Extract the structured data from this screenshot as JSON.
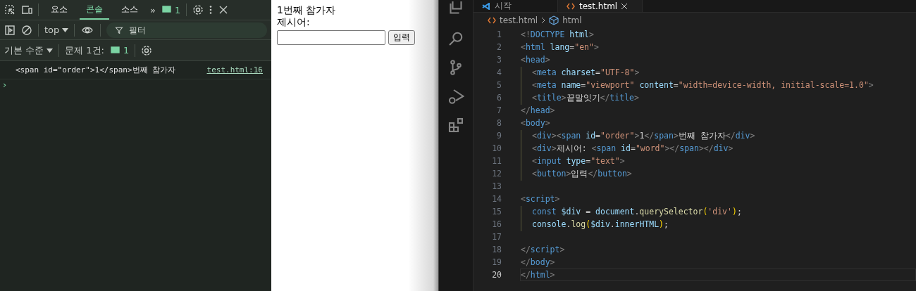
{
  "devtools": {
    "tabs": [
      {
        "label": "요소",
        "selected": false
      },
      {
        "label": "콘솔",
        "selected": true
      },
      {
        "label": "소스",
        "selected": false
      }
    ],
    "more": "»",
    "issues_badge": "1",
    "context": "top",
    "filter": {
      "placeholder": "필터"
    },
    "level_menu": "기본 수준",
    "issues_label": "문제 1건:",
    "issues_count": "1",
    "messages": [
      {
        "text": "<span id=\"order\">1</span>번째 참가자",
        "source": "test.html:16"
      }
    ],
    "prompt": "›"
  },
  "page": {
    "lines": [
      "1번째 참가자",
      "제시어:"
    ],
    "button": "입력"
  },
  "editor": {
    "tabs": [
      {
        "label": "시작",
        "selected": false
      },
      {
        "label": "test.html",
        "selected": true
      }
    ],
    "breadcrumb": [
      "test.html",
      "html"
    ],
    "lines": [
      {
        "n": "1",
        "current": false,
        "tokens": [
          {
            "t": "<!",
            "kind": "punct"
          },
          {
            "t": "DOCTYPE",
            "kind": "tag"
          },
          {
            "t": " html",
            "kind": "attr"
          },
          {
            "t": ">",
            "kind": "punct"
          }
        ]
      },
      {
        "n": "2",
        "current": false,
        "tokens": [
          {
            "t": "<",
            "kind": "punct"
          },
          {
            "t": "html",
            "kind": "tag"
          },
          {
            "t": " lang",
            "kind": "attr"
          },
          {
            "t": "=",
            "kind": "text"
          },
          {
            "t": "\"en\"",
            "kind": "string"
          },
          {
            "t": ">",
            "kind": "punct"
          }
        ]
      },
      {
        "n": "3",
        "current": false,
        "tokens": [
          {
            "t": "<",
            "kind": "punct"
          },
          {
            "t": "head",
            "kind": "tag"
          },
          {
            "t": ">",
            "kind": "punct"
          }
        ],
        "children": [
          {
            "n": "4",
            "current": false,
            "tokens": [
              {
                "t": "<",
                "kind": "punct"
              },
              {
                "t": "meta",
                "kind": "tag"
              },
              {
                "t": " charset",
                "kind": "attr"
              },
              {
                "t": "=",
                "kind": "text"
              },
              {
                "t": "\"UTF-8\"",
                "kind": "string"
              },
              {
                "t": ">",
                "kind": "punct"
              }
            ]
          },
          {
            "n": "5",
            "current": false,
            "tokens": [
              {
                "t": "<",
                "kind": "punct"
              },
              {
                "t": "meta",
                "kind": "tag"
              },
              {
                "t": " name",
                "kind": "attr"
              },
              {
                "t": "=",
                "kind": "text"
              },
              {
                "t": "\"viewport\"",
                "kind": "string"
              },
              {
                "t": " content",
                "kind": "attr"
              },
              {
                "t": "=",
                "kind": "text"
              },
              {
                "t": "\"width=device-width, initial-scale=1.0\"",
                "kind": "string"
              },
              {
                "t": ">",
                "kind": "punct"
              }
            ]
          },
          {
            "n": "6",
            "current": false,
            "tokens": [
              {
                "t": "<",
                "kind": "punct"
              },
              {
                "t": "title",
                "kind": "tag"
              },
              {
                "t": ">",
                "kind": "punct"
              },
              {
                "t": "끝말잇기",
                "kind": "text"
              },
              {
                "t": "</",
                "kind": "punct"
              },
              {
                "t": "title",
                "kind": "tag"
              },
              {
                "t": ">",
                "kind": "punct"
              }
            ]
          }
        ]
      },
      {
        "n": "7",
        "current": false,
        "tokens": [
          {
            "t": "</",
            "kind": "punct"
          },
          {
            "t": "head",
            "kind": "tag"
          },
          {
            "t": ">",
            "kind": "punct"
          }
        ]
      },
      {
        "n": "8",
        "current": false,
        "tokens": [
          {
            "t": "<",
            "kind": "punct"
          },
          {
            "t": "body",
            "kind": "tag"
          },
          {
            "t": ">",
            "kind": "punct"
          }
        ],
        "children": [
          {
            "n": "9",
            "current": false,
            "tokens": [
              {
                "t": "<",
                "kind": "punct"
              },
              {
                "t": "div",
                "kind": "tag"
              },
              {
                "t": "><",
                "kind": "punct"
              },
              {
                "t": "span",
                "kind": "tag"
              },
              {
                "t": " id",
                "kind": "attr"
              },
              {
                "t": "=",
                "kind": "text"
              },
              {
                "t": "\"order\"",
                "kind": "string"
              },
              {
                "t": ">",
                "kind": "punct"
              },
              {
                "t": "1",
                "kind": "text"
              },
              {
                "t": "</",
                "kind": "punct"
              },
              {
                "t": "span",
                "kind": "tag"
              },
              {
                "t": ">",
                "kind": "punct"
              },
              {
                "t": "번째 참가자",
                "kind": "text"
              },
              {
                "t": "</",
                "kind": "punct"
              },
              {
                "t": "div",
                "kind": "tag"
              },
              {
                "t": ">",
                "kind": "punct"
              }
            ]
          },
          {
            "n": "10",
            "current": false,
            "tokens": [
              {
                "t": "<",
                "kind": "punct"
              },
              {
                "t": "div",
                "kind": "tag"
              },
              {
                "t": ">",
                "kind": "punct"
              },
              {
                "t": "제시어: ",
                "kind": "text"
              },
              {
                "t": "<",
                "kind": "punct"
              },
              {
                "t": "span",
                "kind": "tag"
              },
              {
                "t": " id",
                "kind": "attr"
              },
              {
                "t": "=",
                "kind": "text"
              },
              {
                "t": "\"word\"",
                "kind": "string"
              },
              {
                "t": "></",
                "kind": "punct"
              },
              {
                "t": "span",
                "kind": "tag"
              },
              {
                "t": "></",
                "kind": "punct"
              },
              {
                "t": "div",
                "kind": "tag"
              },
              {
                "t": ">",
                "kind": "punct"
              }
            ]
          },
          {
            "n": "11",
            "current": false,
            "tokens": [
              {
                "t": "<",
                "kind": "punct"
              },
              {
                "t": "input",
                "kind": "tag"
              },
              {
                "t": " type",
                "kind": "attr"
              },
              {
                "t": "=",
                "kind": "text"
              },
              {
                "t": "\"text\"",
                "kind": "string"
              },
              {
                "t": ">",
                "kind": "punct"
              }
            ]
          },
          {
            "n": "12",
            "current": false,
            "tokens": [
              {
                "t": "<",
                "kind": "punct"
              },
              {
                "t": "button",
                "kind": "tag"
              },
              {
                "t": ">",
                "kind": "punct"
              },
              {
                "t": "입력",
                "kind": "text"
              },
              {
                "t": "</",
                "kind": "punct"
              },
              {
                "t": "button",
                "kind": "tag"
              },
              {
                "t": ">",
                "kind": "punct"
              }
            ]
          }
        ]
      },
      {
        "n": "13",
        "current": false
      },
      {
        "n": "14",
        "current": false,
        "tokens": [
          {
            "t": "<",
            "kind": "punct"
          },
          {
            "t": "script",
            "kind": "tag"
          },
          {
            "t": ">",
            "kind": "punct"
          }
        ],
        "children": [
          {
            "n": "15",
            "current": false,
            "tokens": [
              {
                "t": "const",
                "kind": "tag"
              },
              {
                "t": " $div",
                "kind": "attr"
              },
              {
                "t": " = ",
                "kind": "text"
              },
              {
                "t": "document",
                "kind": "attr"
              },
              {
                "t": ".",
                "kind": "text"
              },
              {
                "t": "querySelector",
                "kind": "function"
              },
              {
                "t": "(",
                "kind": "bracket"
              },
              {
                "t": "'div'",
                "kind": "string"
              },
              {
                "t": ")",
                "kind": "bracket"
              },
              {
                "t": ";",
                "kind": "text"
              }
            ]
          },
          {
            "n": "16",
            "current": false,
            "tokens": [
              {
                "t": "console",
                "kind": "attr"
              },
              {
                "t": ".",
                "kind": "text"
              },
              {
                "t": "log",
                "kind": "function"
              },
              {
                "t": "(",
                "kind": "bracket"
              },
              {
                "t": "$div",
                "kind": "attr"
              },
              {
                "t": ".",
                "kind": "text"
              },
              {
                "t": "innerHTML",
                "kind": "attr"
              },
              {
                "t": ")",
                "kind": "bracket"
              },
              {
                "t": ";",
                "kind": "text"
              }
            ]
          }
        ]
      },
      {
        "n": "17",
        "current": false
      },
      {
        "n": "18",
        "current": false,
        "tokens": [
          {
            "t": "</",
            "kind": "punct"
          },
          {
            "t": "script",
            "kind": "tag"
          },
          {
            "t": ">",
            "kind": "punct"
          }
        ]
      },
      {
        "n": "19",
        "current": false,
        "tokens": [
          {
            "t": "</",
            "kind": "punct"
          },
          {
            "t": "body",
            "kind": "tag"
          },
          {
            "t": ">",
            "kind": "punct"
          }
        ]
      },
      {
        "n": "20",
        "current": true,
        "tokens": [
          {
            "t": "</",
            "kind": "punct"
          },
          {
            "t": "html",
            "kind": "tag"
          },
          {
            "t": ">",
            "kind": "punct"
          }
        ]
      }
    ]
  }
}
